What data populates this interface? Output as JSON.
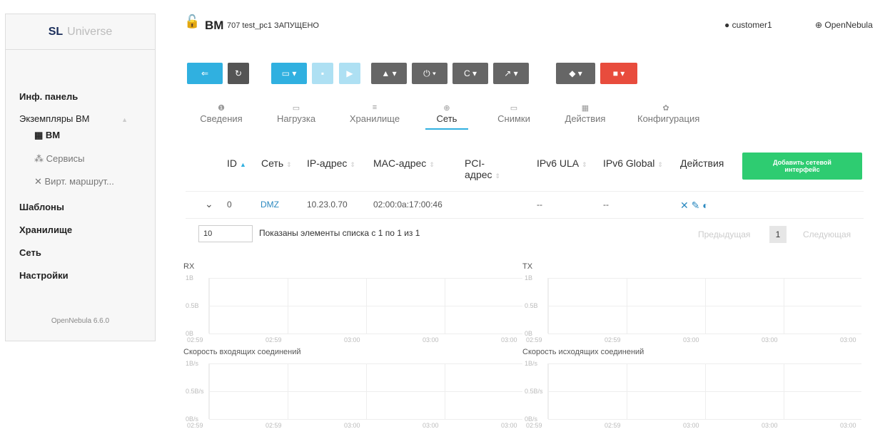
{
  "brand": {
    "sl": "SL",
    "name": "Universe"
  },
  "sidebar": {
    "dashboard": "Инф. панель",
    "instances": "Экземпляры ВМ",
    "vms": "ВМ",
    "services": "Сервисы",
    "vrouters": "Вирт. маршрут...",
    "templates": "Шаблоны",
    "storage": "Хранилище",
    "network": "Сеть",
    "settings": "Настройки",
    "version": "OpenNebula 6.6.0"
  },
  "header": {
    "title": "ВМ",
    "subtitle": "707 test_pc1 ЗАПУЩЕНО",
    "user": "customer1",
    "zone": "OpenNebula"
  },
  "tabs": [
    "Сведения",
    "Нагрузка",
    "Хранилище",
    "Сеть",
    "Снимки",
    "Действия",
    "Конфигурация"
  ],
  "table": {
    "headers": [
      "ID",
      "Сеть",
      "IP-адрес",
      "MAC-адрес",
      "PCI-\nадрес",
      "IPv6 ULA",
      "IPv6 Global",
      "Действия"
    ],
    "add_button": "Добавить сетевой интерфейс",
    "row": {
      "id": "0",
      "net": "DMZ",
      "ip": "10.23.0.70",
      "mac": "02:00:0a:17:00:46",
      "ula": "--",
      "global": "--"
    },
    "page_size": "10",
    "info": "Показаны элементы списка с 1 по 1 из 1",
    "prev": "Предыдущая",
    "page": "1",
    "next": "Следующая"
  },
  "charts": {
    "rx": "RX",
    "tx": "TX",
    "in_speed": "Скорость входящих соединений",
    "out_speed": "Скорость исходящих соединений",
    "y_bytes": [
      "1B",
      "0.5B",
      "0B"
    ],
    "y_rate": [
      "1B/s",
      "0.5B/s",
      "0B/s"
    ],
    "x": [
      "02:59",
      "02:59",
      "03:00",
      "03:00",
      "03:00"
    ]
  }
}
